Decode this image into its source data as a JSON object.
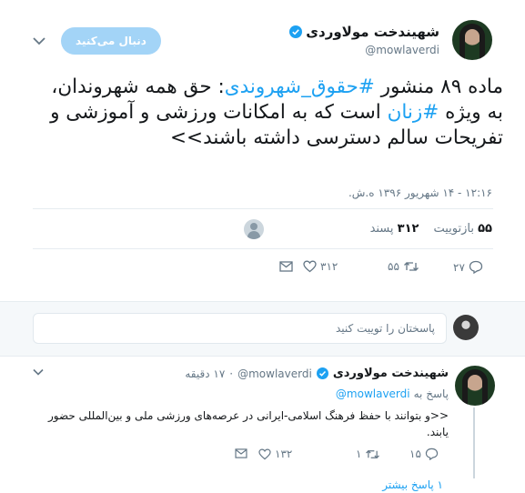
{
  "main_tweet": {
    "display_name": "شهیندخت مولاوردی",
    "handle": "@mowlaverdi",
    "follow_button": "دنبال می‌کنید",
    "text_parts": [
      {
        "text": "ماده ۸۹ منشور ",
        "link": false
      },
      {
        "text": "#حقوق_شهروندی",
        "link": true
      },
      {
        "text": ": حق همه شهروندان، به ویژه ",
        "link": false
      },
      {
        "text": "#زنان",
        "link": true
      },
      {
        "text": " است که به امکانات ورزشی و آموزشی و تفریحات سالم دسترسی داشته باشند>>",
        "link": false
      }
    ],
    "timestamp": "۱۲:۱۶ - ۱۴ شهریور ۱۳۹۶ ه.ش.",
    "retweets_count": "۵۵",
    "retweets_label": "بازتوییت",
    "likes_count": "۳۱۲",
    "likes_label": "پسند",
    "actions": {
      "reply": "۲۷",
      "retweet": "۵۵",
      "like": "۳۱۲"
    }
  },
  "reply_box": {
    "placeholder": "پاسختان را توییت کنید"
  },
  "reply_tweet": {
    "display_name": "شهیندخت مولاوردی",
    "handle": "@mowlaverdi",
    "time": "۱۷ دقیقه",
    "replying_to_label": "پاسخ به",
    "replying_to_handle": "@mowlaverdi",
    "text": "<<و بتوانند با حفظ فرهنگ اسلامی-ایرانی در عرصه‌های ورزشی ملی و بین‌المللی حضور یابند.",
    "actions": {
      "reply": "۱۵",
      "retweet": "۱",
      "like": "۱۳۲"
    },
    "more_replies": "۱ پاسخ بیشتر"
  },
  "colors": {
    "accent": "#1da1f2",
    "follow_button_bg": "#a3d4f7",
    "verified": "#1da1f2"
  }
}
